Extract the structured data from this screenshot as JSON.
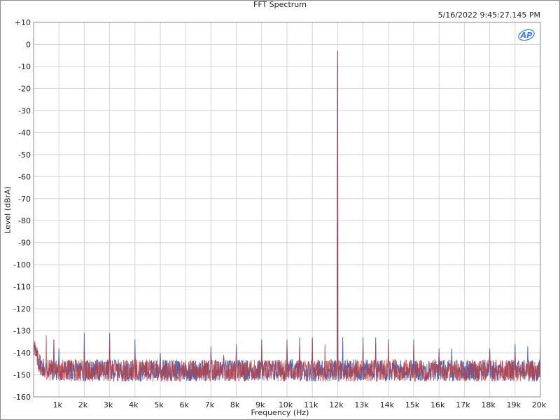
{
  "header": {
    "title": "FFT Spectrum",
    "timestamp": "5/16/2022 9:45:27.145 PM"
  },
  "logo": {
    "icon": "ap-logo-icon",
    "text": "AP",
    "color": "#3a7bd5"
  },
  "chart_data": {
    "type": "line",
    "title": "FFT Spectrum",
    "xlabel": "Frequency (Hz)",
    "ylabel": "Level (dBrA)",
    "xlim": [
      0,
      20000
    ],
    "ylim": [
      -160,
      10
    ],
    "grid": true,
    "x_ticks": [
      1000,
      2000,
      3000,
      4000,
      5000,
      6000,
      7000,
      8000,
      9000,
      10000,
      11000,
      12000,
      13000,
      14000,
      15000,
      16000,
      17000,
      18000,
      19000,
      20000
    ],
    "x_tick_labels": [
      "1k",
      "2k",
      "3k",
      "4k",
      "5k",
      "6k",
      "7k",
      "8k",
      "9k",
      "10k",
      "11k",
      "12k",
      "13k",
      "14k",
      "15k",
      "16k",
      "17k",
      "18k",
      "19k",
      "20k"
    ],
    "y_ticks": [
      10,
      0,
      -10,
      -20,
      -30,
      -40,
      -50,
      -60,
      -70,
      -80,
      -90,
      -100,
      -110,
      -120,
      -130,
      -140,
      -150,
      -160
    ],
    "y_tick_labels": [
      "+10",
      "0",
      "-10",
      "-20",
      "-30",
      "-40",
      "-50",
      "-60",
      "-70",
      "-80",
      "-90",
      "-100",
      "-110",
      "-120",
      "-130",
      "-140",
      "-150",
      "-160"
    ],
    "noise_floor_db": -148,
    "series": [
      {
        "color": "#3d5aa8",
        "peaks": [
          {
            "x": 800,
            "y": -134
          },
          {
            "x": 1000,
            "y": -138
          },
          {
            "x": 2000,
            "y": -131
          },
          {
            "x": 3000,
            "y": -131
          },
          {
            "x": 4000,
            "y": -134
          },
          {
            "x": 5000,
            "y": -140
          },
          {
            "x": 7000,
            "y": -137
          },
          {
            "x": 7500,
            "y": -141
          },
          {
            "x": 8000,
            "y": -136
          },
          {
            "x": 9000,
            "y": -134
          },
          {
            "x": 10000,
            "y": -134
          },
          {
            "x": 10500,
            "y": -133
          },
          {
            "x": 11000,
            "y": -133
          },
          {
            "x": 12000,
            "y": -3
          },
          {
            "x": 12200,
            "y": -133
          },
          {
            "x": 13000,
            "y": -133
          },
          {
            "x": 13500,
            "y": -133
          },
          {
            "x": 14000,
            "y": -134
          },
          {
            "x": 15000,
            "y": -134
          },
          {
            "x": 16000,
            "y": -138
          },
          {
            "x": 16500,
            "y": -138
          },
          {
            "x": 18000,
            "y": -138
          },
          {
            "x": 19000,
            "y": -136
          },
          {
            "x": 19500,
            "y": -137
          },
          {
            "x": 20000,
            "y": -134
          }
        ]
      },
      {
        "color": "#c23a3a",
        "peaks": [
          {
            "x": 500,
            "y": -132
          },
          {
            "x": 800,
            "y": -134
          },
          {
            "x": 2000,
            "y": -139
          },
          {
            "x": 3000,
            "y": -134
          },
          {
            "x": 4000,
            "y": -140
          },
          {
            "x": 7000,
            "y": -140
          },
          {
            "x": 7500,
            "y": -142
          },
          {
            "x": 8000,
            "y": -140
          },
          {
            "x": 9000,
            "y": -136
          },
          {
            "x": 10000,
            "y": -136
          },
          {
            "x": 10500,
            "y": -136
          },
          {
            "x": 11000,
            "y": -134
          },
          {
            "x": 11500,
            "y": -136
          },
          {
            "x": 12000,
            "y": -3
          },
          {
            "x": 13000,
            "y": -136
          },
          {
            "x": 13500,
            "y": -136
          },
          {
            "x": 14000,
            "y": -136
          },
          {
            "x": 15000,
            "y": -136
          },
          {
            "x": 16000,
            "y": -140
          },
          {
            "x": 18000,
            "y": -140
          },
          {
            "x": 19000,
            "y": -140
          },
          {
            "x": 20000,
            "y": -138
          }
        ]
      }
    ]
  }
}
